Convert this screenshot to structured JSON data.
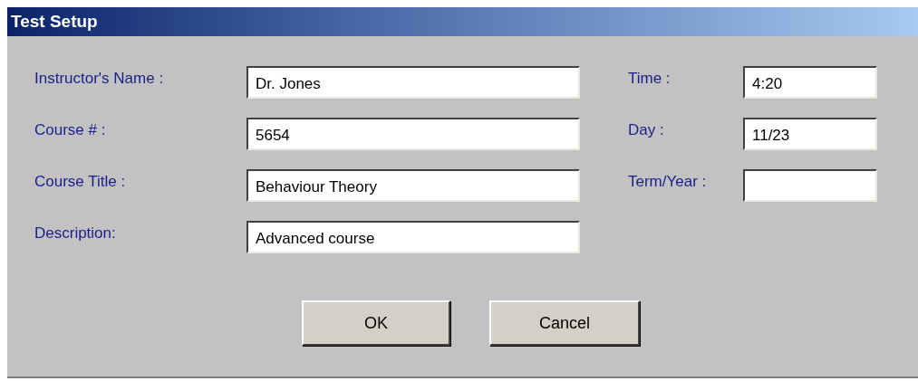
{
  "window": {
    "title": "Test Setup"
  },
  "left_fields": [
    {
      "label": "Instructor's Name :",
      "value": "Dr. Jones"
    },
    {
      "label": "Course # :",
      "value": "5654"
    },
    {
      "label": "Course Title :",
      "value": "Behaviour Theory"
    },
    {
      "label": "Description:",
      "value": "Advanced course"
    }
  ],
  "right_fields": [
    {
      "label": "Time :",
      "value": "4:20"
    },
    {
      "label": "Day :",
      "value": "11/23"
    },
    {
      "label": "Term/Year :"
    }
  ],
  "buttons": [
    "OK",
    "Cancel"
  ]
}
